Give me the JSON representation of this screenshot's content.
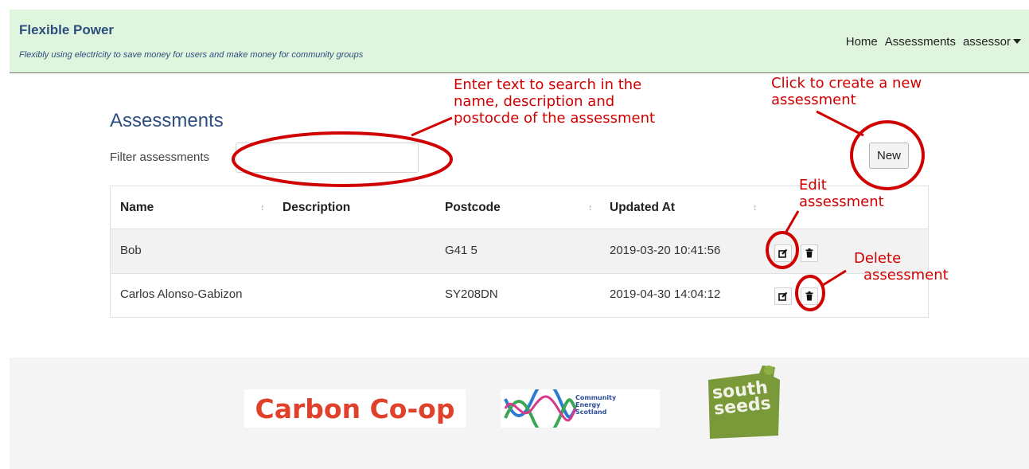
{
  "header": {
    "brand": "Flexible Power",
    "tagline": "Flexibly using electricity to save money for users and make money for community groups",
    "nav": [
      "Home",
      "Assessments",
      "assessor"
    ]
  },
  "page": {
    "title": "Assessments",
    "filter_label": "Filter assessments",
    "filter_value": "",
    "new_button": "New"
  },
  "table": {
    "columns": [
      "Name",
      "Description",
      "Postcode",
      "Updated At"
    ],
    "rows": [
      {
        "name": "Bob",
        "description": "",
        "postcode": "G41 5",
        "updated_at": "2019-03-20 10:41:56"
      },
      {
        "name": "Carlos Alonso-Gabizon",
        "description": "",
        "postcode": "SY208DN",
        "updated_at": "2019-04-30 14:04:12"
      }
    ]
  },
  "annotations": {
    "search": [
      "Enter text to search in the",
      "name, description and",
      "postocde of the assessment"
    ],
    "new": [
      "Click to create a new",
      "assessment"
    ],
    "edit": [
      "Edit",
      "assessment"
    ],
    "delete": [
      "Delete",
      "assessment"
    ],
    "color": "#d00000"
  },
  "footer": {
    "logos": {
      "carbon": "Carbon Co-op",
      "ces": [
        "Community",
        "Energy",
        "Scotland"
      ],
      "south": [
        "south",
        "seeds"
      ]
    }
  },
  "icons": [
    "edit-icon",
    "trash-icon",
    "sort-icon",
    "caret-down-icon"
  ]
}
